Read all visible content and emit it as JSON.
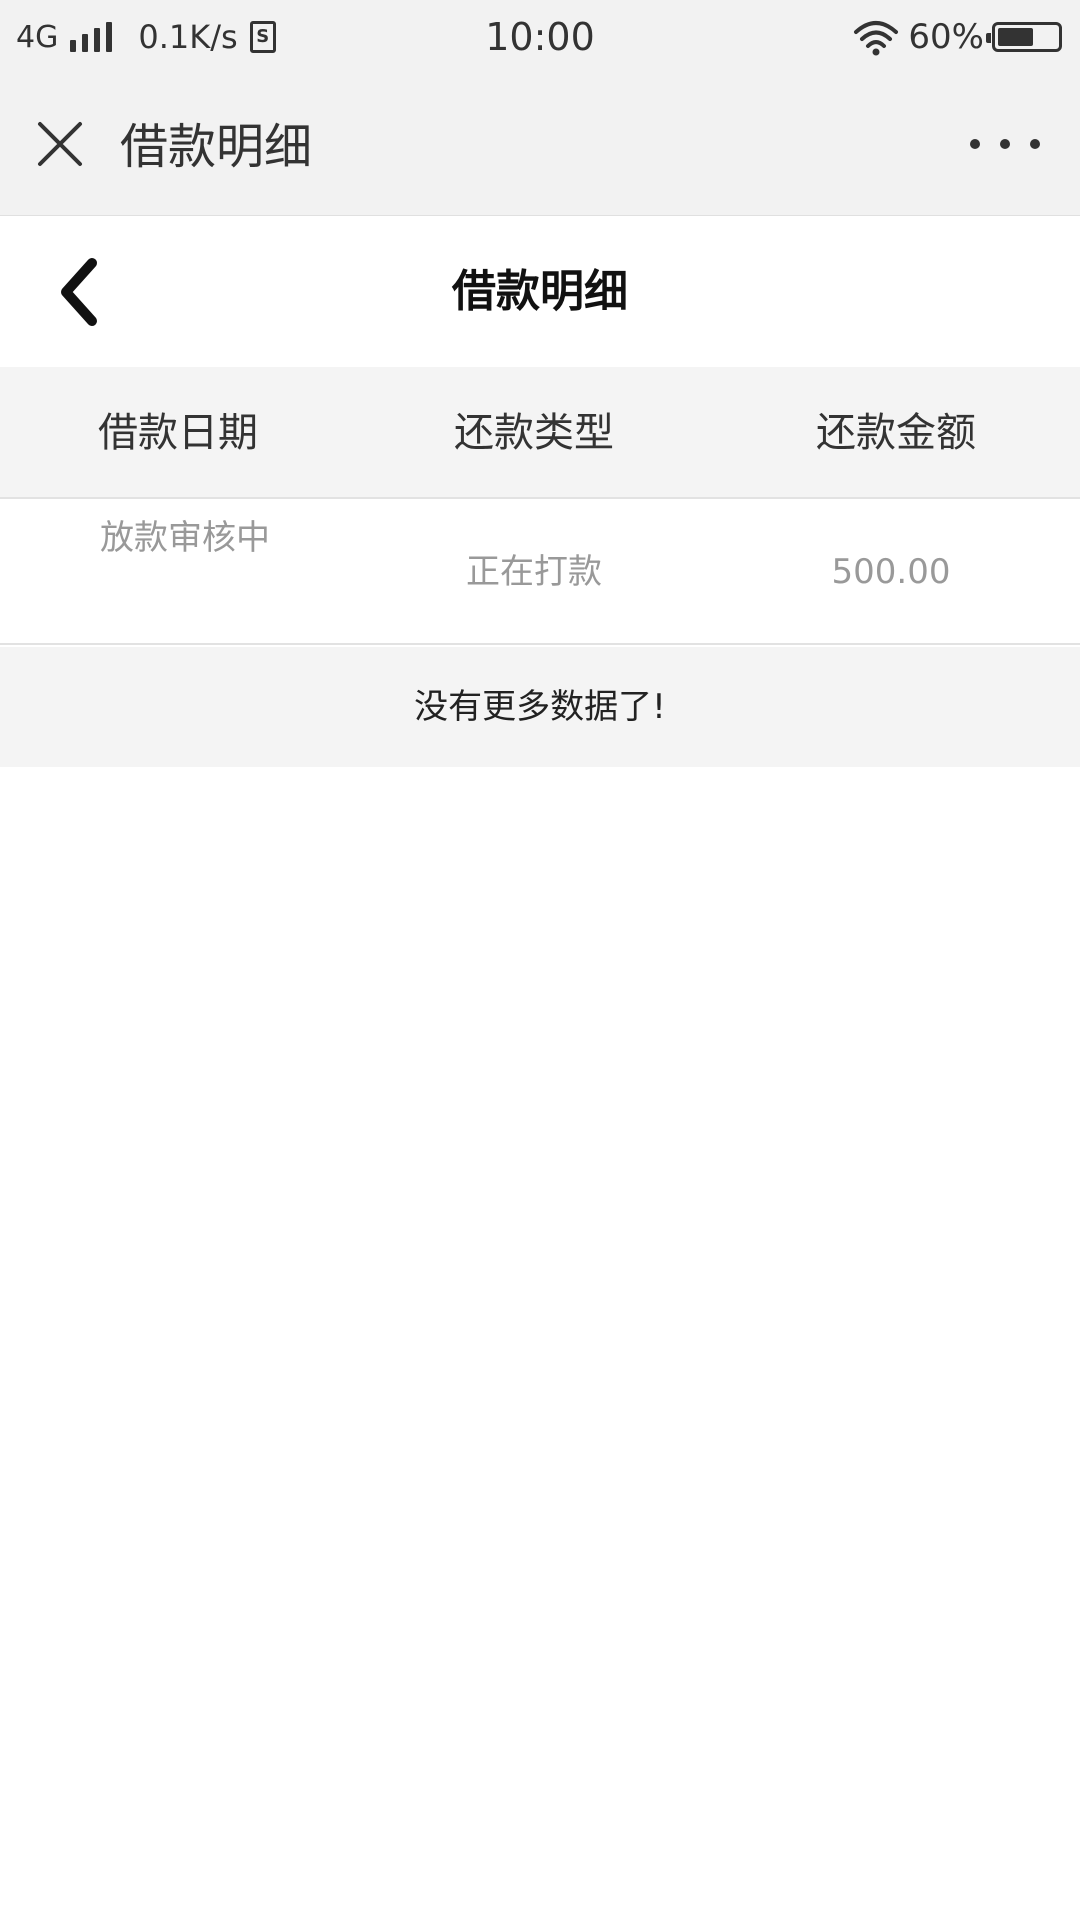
{
  "status_bar": {
    "network": "4G",
    "speed": "0.1K/s",
    "sim_label": "S",
    "time": "10:00",
    "battery_percent": "60%",
    "battery_level": 0.6
  },
  "top_bar": {
    "title": "借款明细"
  },
  "page": {
    "title": "借款明细"
  },
  "table": {
    "columns": [
      "借款日期",
      "还款类型",
      "还款金额"
    ],
    "rows": [
      {
        "date": "放款审核中",
        "type": "正在打款",
        "amount": "500.00"
      }
    ],
    "empty_message": "没有更多数据了!"
  }
}
